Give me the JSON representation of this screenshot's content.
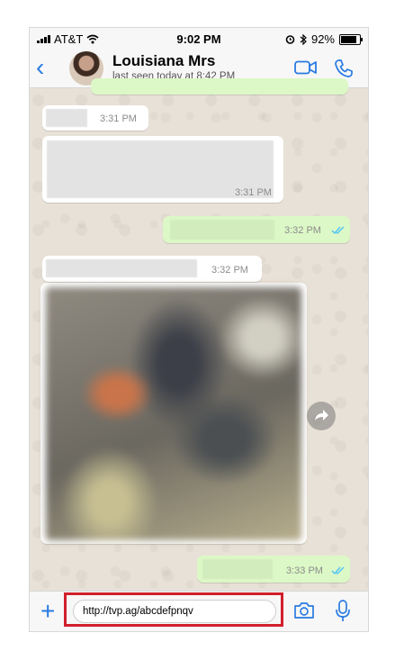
{
  "status_bar": {
    "carrier": "AT&T",
    "time": "9:02 PM",
    "battery": "92%",
    "battery_level": 0.92,
    "icons": [
      "signal-icon",
      "wifi-icon",
      "alarm-icon",
      "bluetooth-icon",
      "battery-icon"
    ]
  },
  "header": {
    "back_icon": "chevron-left-icon",
    "contact_name": "Louisiana Mrs",
    "last_seen": "last seen today at 8:42 PM",
    "video_icon": "video-call-icon",
    "phone_icon": "phone-icon"
  },
  "messages": [
    {
      "direction": "incoming",
      "time": "3:31 PM"
    },
    {
      "direction": "incoming",
      "time": "3:31 PM"
    },
    {
      "direction": "outgoing",
      "time": "3:32 PM",
      "read": true
    },
    {
      "direction": "incoming",
      "time": "3:32 PM"
    },
    {
      "direction": "incoming",
      "type": "photo"
    },
    {
      "direction": "outgoing",
      "time": "3:33 PM",
      "read": true
    }
  ],
  "input_bar": {
    "attach_icon": "plus-icon",
    "message_value": "http://tvp.ag/abcdefpnqv",
    "camera_icon": "camera-icon",
    "mic_icon": "microphone-icon",
    "highlight_color": "#d21f2c"
  },
  "colors": {
    "accent": "#2a7ae2",
    "outgoing_bubble": "#dcf8c6",
    "incoming_bubble": "#ffffff",
    "read_ticks": "#4fc3f7"
  }
}
